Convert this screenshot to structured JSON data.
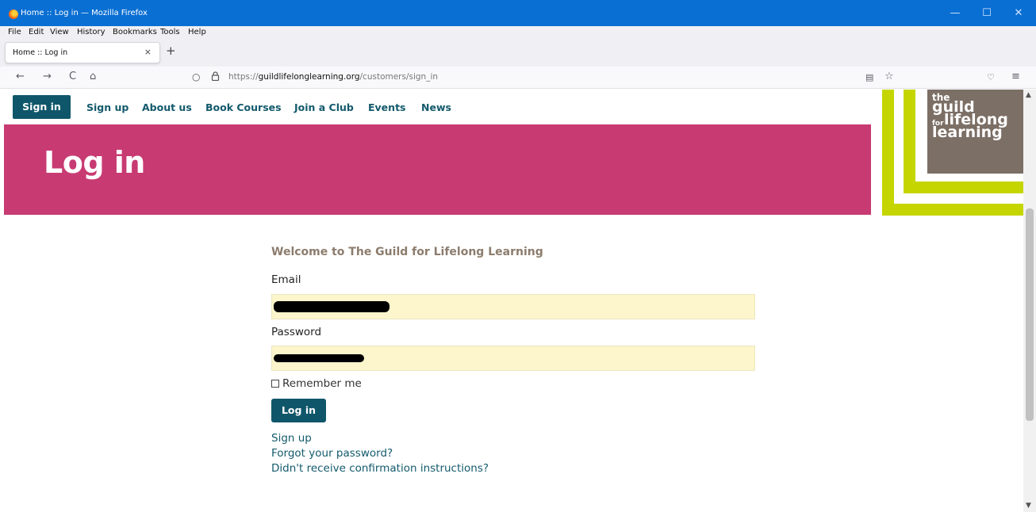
{
  "window": {
    "title": "Home :: Log in — Mozilla Firefox",
    "controls": {
      "minimize": "—",
      "maximize": "☐",
      "close": "✕"
    }
  },
  "menubar": {
    "items": [
      "File",
      "Edit",
      "View",
      "History",
      "Bookmarks",
      "Tools",
      "Help"
    ]
  },
  "tabs": [
    {
      "label": "Home :: Log in",
      "close": "×"
    }
  ],
  "new_tab": "+",
  "navbar": {
    "back": "←",
    "forward": "→",
    "reload": "C",
    "home": "⌂",
    "url_prefix": "https://",
    "url_domain": "guildlifelonglearning.org",
    "url_path": "/customers/sign_in",
    "reader_icon": "▤",
    "bookmark_icon": "☆",
    "pocket_icon": "♡",
    "menu_icon": "≡",
    "shield_icon": "○",
    "lock_icon": "🔒"
  },
  "site_nav": {
    "items": [
      "Sign in",
      "Sign up",
      "About us",
      "Book Courses",
      "Join a Club",
      "Events",
      "News"
    ]
  },
  "hero": {
    "title": "Log in"
  },
  "logo": {
    "line1": "the",
    "line2": "guild",
    "line3_small": "for",
    "line3": "lifelong",
    "line4": "learning"
  },
  "form": {
    "welcome": "Welcome to The Guild for Lifelong Learning",
    "email_label": "Email",
    "password_label": "Password",
    "remember_label": "Remember me",
    "submit": "Log in",
    "links": [
      "Sign up",
      "Forgot your password?",
      "Didn't receive confirmation instructions?"
    ]
  },
  "colors": {
    "titlebar": "#0a6fd3",
    "brand_teal": "#10566a",
    "hero_pink": "#c83a72",
    "lime": "#c5d500",
    "logo_brown": "#7c6f66",
    "field_bg": "#fdf5cb"
  }
}
